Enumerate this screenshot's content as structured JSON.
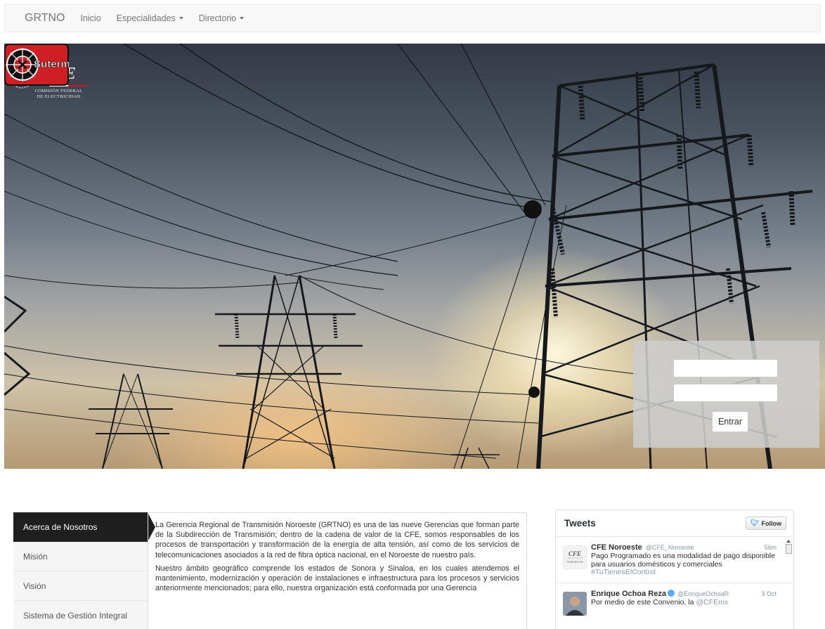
{
  "navbar": {
    "brand": "GRTNO",
    "items": [
      {
        "label": "Inicio",
        "dropdown": false
      },
      {
        "label": "Especialidades",
        "dropdown": true
      },
      {
        "label": "Directorio",
        "dropdown": true
      }
    ]
  },
  "hero": {
    "logos": {
      "cfe_mark": "CFE",
      "cfe_subtitle_1": "COMISIÓN FEDERAL",
      "cfe_subtitle_2": "DE ELECTRICIDAD",
      "union_mark": "Suterm"
    },
    "login": {
      "username_value": "",
      "password_value": "",
      "submit_label": "Entrar"
    }
  },
  "sidenav": {
    "items": [
      {
        "label": "Acerca de Nosotros",
        "active": true
      },
      {
        "label": "Misión",
        "active": false
      },
      {
        "label": "Visión",
        "active": false
      },
      {
        "label": "Sistema de Gestión Integral",
        "active": false
      }
    ]
  },
  "about": {
    "paragraphs": [
      "La Gerencia Regional de Transmisión Noroeste (GRTNO) es una de las nueve Gerencias que forman parte de la Subdirección de Transmisión; dentro de la cadena de valor de la CFE, somos responsables de los procesos de transportación y transformación de la energía de alta tensión, así como de los servicios de telecomunicaciones asociados a la red de fibra óptica nacional, en el Noroeste de nuestro país.",
      "Nuestro ámbito geográfico comprende los estados de Sonora y Sinaloa, en los cuales atendemos el mantenimiento, modernización y operación de instalaciones e infraestructura para los procesos y servicios anteriormente mencionados; para ello, nuestra organización está conformada por una Gerencia"
    ]
  },
  "tweets": {
    "title": "Tweets",
    "follow_label": "Follow",
    "items": [
      {
        "name": "CFE Noroeste",
        "handle": "@CFE_Noroeste",
        "time": "56m",
        "text": "Pago Programado es una modalidad de pago disponible para usuarios domésticos y comerciales",
        "hashtag": "#TuTienesElControl",
        "avatar_text": "CFE",
        "avatar_sub": "NOROESTE"
      },
      {
        "name": "Enrique Ochoa Reza",
        "handle": "@EnriqueOchoaR",
        "time": "3 Oct",
        "text": "Por medio de este Convenio, la",
        "hashtag": "@CFEmx"
      }
    ]
  },
  "colors": {
    "navbar_bg": "#f8f8f8",
    "active_nav": "#1f1f1f",
    "twitter_blue": "#55acee",
    "cfe_green": "#006847",
    "cfe_red": "#ce1126"
  }
}
